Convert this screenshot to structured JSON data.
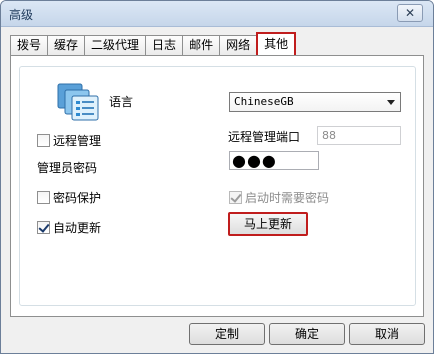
{
  "window": {
    "title": "高级",
    "close_symbol": "✕"
  },
  "tabs": [
    {
      "label": "拨号"
    },
    {
      "label": "缓存"
    },
    {
      "label": "二级代理"
    },
    {
      "label": "日志"
    },
    {
      "label": "邮件"
    },
    {
      "label": "网络"
    },
    {
      "label": "其他",
      "active": true
    }
  ],
  "settings": {
    "language_label": "语言",
    "language_value": "ChineseGB",
    "remote_mgmt_label": "远程管理",
    "remote_mgmt_checked": false,
    "remote_port_label": "远程管理端口",
    "remote_port_value": "88",
    "admin_password_label": "管理员密码",
    "admin_password_mask": "●●●",
    "password_protect_label": "密码保护",
    "password_protect_checked": false,
    "startup_password_label": "启动时需要密码",
    "startup_password_checked": true,
    "auto_update_label": "自动更新",
    "auto_update_checked": true,
    "update_now_label": "马上更新"
  },
  "footer": {
    "customize_label": "定制",
    "ok_label": "确定",
    "cancel_label": "取消"
  },
  "colors": {
    "highlight_border": "#c01d1d",
    "title_bg": "#c6d6ea",
    "icon": "language-pages-icon"
  }
}
